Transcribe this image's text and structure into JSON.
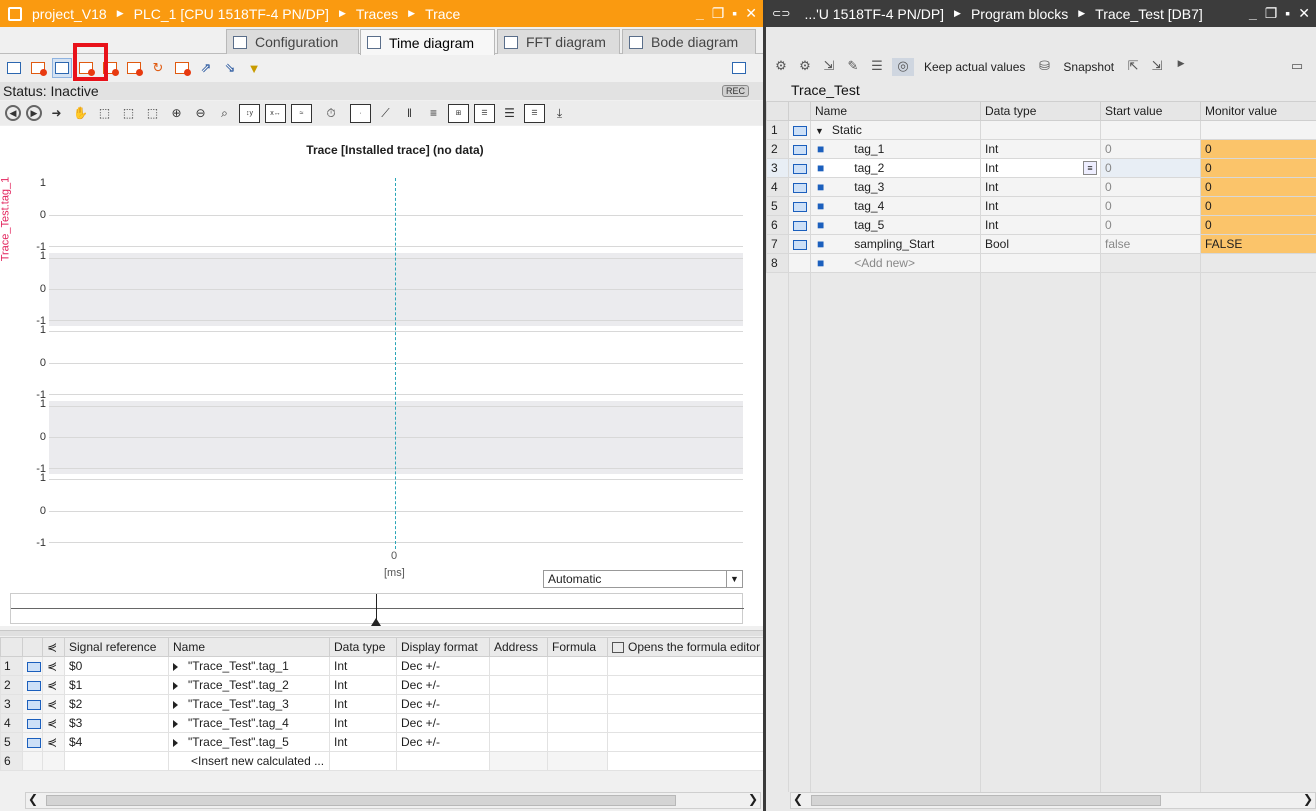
{
  "left_panel": {
    "breadcrumb": [
      "project_V18",
      "PLC_1 [CPU 1518TF-4 PN/DP]",
      "Traces",
      "Trace"
    ],
    "tabs": [
      "Configuration",
      "Time diagram",
      "FFT diagram",
      "Bode diagram"
    ],
    "active_tab": "Time diagram",
    "status": "Status: Inactive",
    "rec_badge": "REC",
    "plot_title": "Trace [Installed trace] (no data)",
    "y_axis_label": "Trace_Test.tag_1",
    "y_ticks": [
      "1",
      "0",
      "-1"
    ],
    "x_tick": "0",
    "x_unit": "[ms]",
    "scale_select": "Automatic",
    "signal_table": {
      "columns": [
        "Signal reference",
        "Name",
        "Data type",
        "Display format",
        "Address",
        "Formula",
        "Opens the formula editor"
      ],
      "rows": [
        {
          "num": "1",
          "ref": "$0",
          "name": "\"Trace_Test\".tag_1",
          "type": "Int",
          "format": "Dec +/-"
        },
        {
          "num": "2",
          "ref": "$1",
          "name": "\"Trace_Test\".tag_2",
          "type": "Int",
          "format": "Dec +/-"
        },
        {
          "num": "3",
          "ref": "$2",
          "name": "\"Trace_Test\".tag_3",
          "type": "Int",
          "format": "Dec +/-"
        },
        {
          "num": "4",
          "ref": "$3",
          "name": "\"Trace_Test\".tag_4",
          "type": "Int",
          "format": "Dec +/-"
        },
        {
          "num": "5",
          "ref": "$4",
          "name": "\"Trace_Test\".tag_5",
          "type": "Int",
          "format": "Dec +/-"
        },
        {
          "num": "6",
          "ref": "",
          "name": "<Insert new calculated ...",
          "type": "",
          "format": ""
        }
      ]
    }
  },
  "right_panel": {
    "breadcrumb": [
      "...'U 1518TF-4 PN/DP]",
      "Program blocks",
      "Trace_Test [DB7]"
    ],
    "toolbar": {
      "keep_actual": "Keep actual values",
      "snapshot": "Snapshot"
    },
    "db_title": "Trace_Test",
    "columns": [
      "Name",
      "Data type",
      "Start value",
      "Monitor value"
    ],
    "rows": [
      {
        "num": "1",
        "name": "Static",
        "type": "",
        "start": "",
        "monitor": ""
      },
      {
        "num": "2",
        "name": "tag_1",
        "type": "Int",
        "start": "0",
        "monitor": "0"
      },
      {
        "num": "3",
        "name": "tag_2",
        "type": "Int",
        "start": "0",
        "monitor": "0"
      },
      {
        "num": "4",
        "name": "tag_3",
        "type": "Int",
        "start": "0",
        "monitor": "0"
      },
      {
        "num": "5",
        "name": "tag_4",
        "type": "Int",
        "start": "0",
        "monitor": "0"
      },
      {
        "num": "6",
        "name": "tag_5",
        "type": "Int",
        "start": "0",
        "monitor": "0"
      },
      {
        "num": "7",
        "name": "sampling_Start",
        "type": "Bool",
        "start": "false",
        "monitor": "FALSE"
      },
      {
        "num": "8",
        "name": "<Add new>",
        "type": "",
        "start": "",
        "monitor": ""
      }
    ]
  },
  "colors": {
    "title_orange": "#fa9a10",
    "monitor_orange": "#fbc46a",
    "highlight_red": "#e8121a",
    "cursor_cyan": "#2aa5b7",
    "ylabel_pink": "#e2235c"
  }
}
